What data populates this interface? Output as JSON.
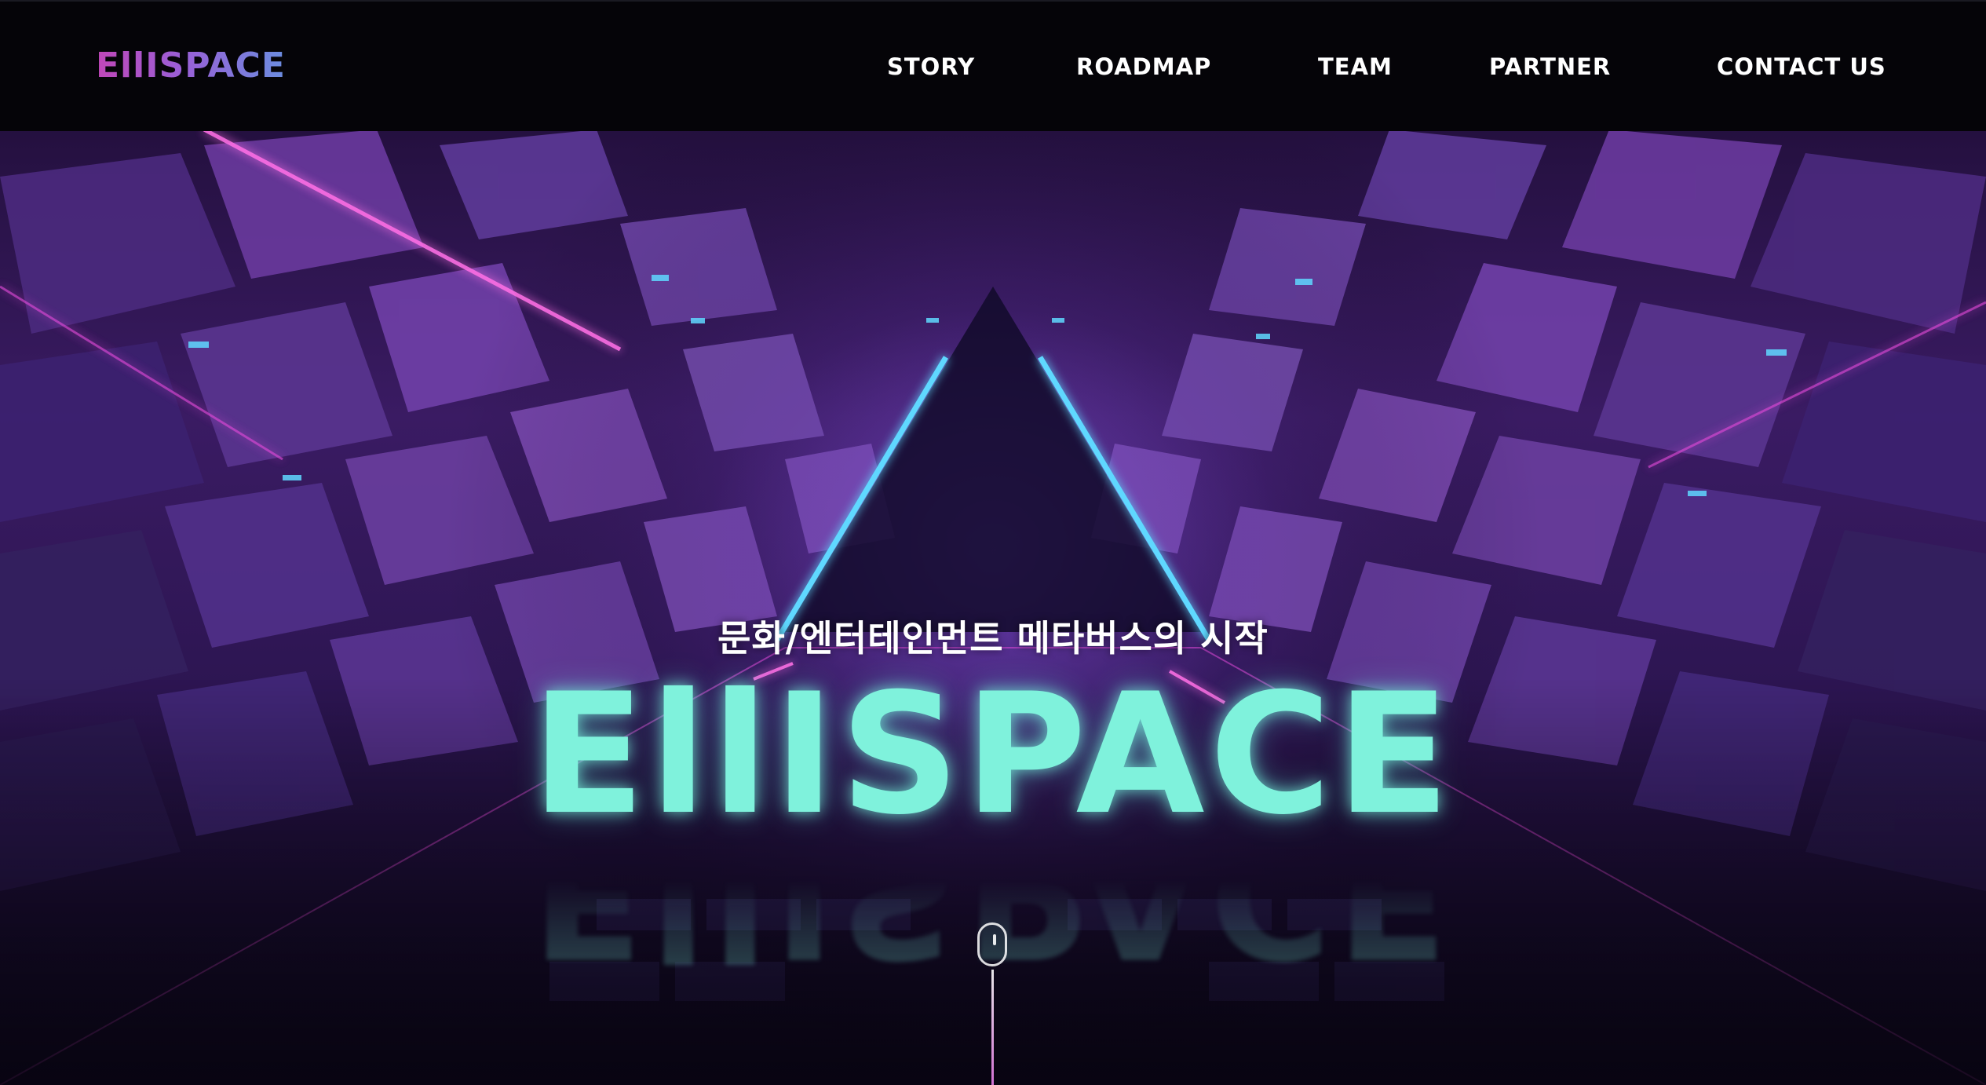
{
  "header": {
    "logo": "EllISPACE",
    "nav": [
      "STORY",
      "ROADMAP",
      "TEAM",
      "PARTNER",
      "CONTACT US"
    ]
  },
  "hero": {
    "tagline": "문화/엔터테인먼트 메타버스의 시작",
    "title": "EllISPACE"
  },
  "colors": {
    "header_bg": "#050408",
    "title_teal": "#7ff2dc",
    "neon_cyan": "#5fd8ff",
    "neon_magenta": "#e04ad8",
    "tile_purple": "#5a2f8f"
  },
  "icons": [
    "mouse-scroll-icon"
  ]
}
